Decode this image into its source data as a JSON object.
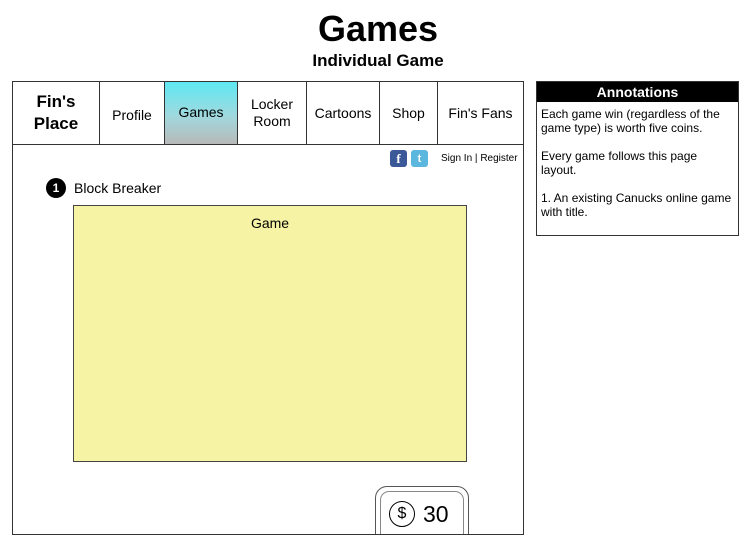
{
  "page": {
    "title": "Games",
    "subtitle": "Individual Game"
  },
  "nav": {
    "logo_line1": "Fin's",
    "logo_line2": "Place",
    "items": [
      {
        "label": "Profile"
      },
      {
        "label": "Games",
        "active": true
      },
      {
        "label_line1": "Locker",
        "label_line2": "Room"
      },
      {
        "label": "Cartoons"
      },
      {
        "label": "Shop"
      },
      {
        "label": "Fin's Fans"
      }
    ]
  },
  "header": {
    "facebook_glyph": "f",
    "twitter_glyph": "t",
    "sign_in": "Sign In",
    "separator": "|",
    "register": "Register"
  },
  "game": {
    "badge_number": "1",
    "title": "Block Breaker",
    "area_label": "Game",
    "area_color": "#f6f4a4"
  },
  "coins": {
    "symbol": "$",
    "count": "30"
  },
  "annotations": {
    "header": "Annotations",
    "notes": [
      "Each game win (regardless of the game type) is worth five coins.",
      "Every game follows this page layout.",
      "1. An existing Canucks online game with title."
    ]
  },
  "colors": {
    "active_tab_top": "#5ee8f2",
    "active_tab_bottom": "#b8b8b8",
    "facebook": "#3b5998",
    "twitter": "#5bb7de"
  }
}
